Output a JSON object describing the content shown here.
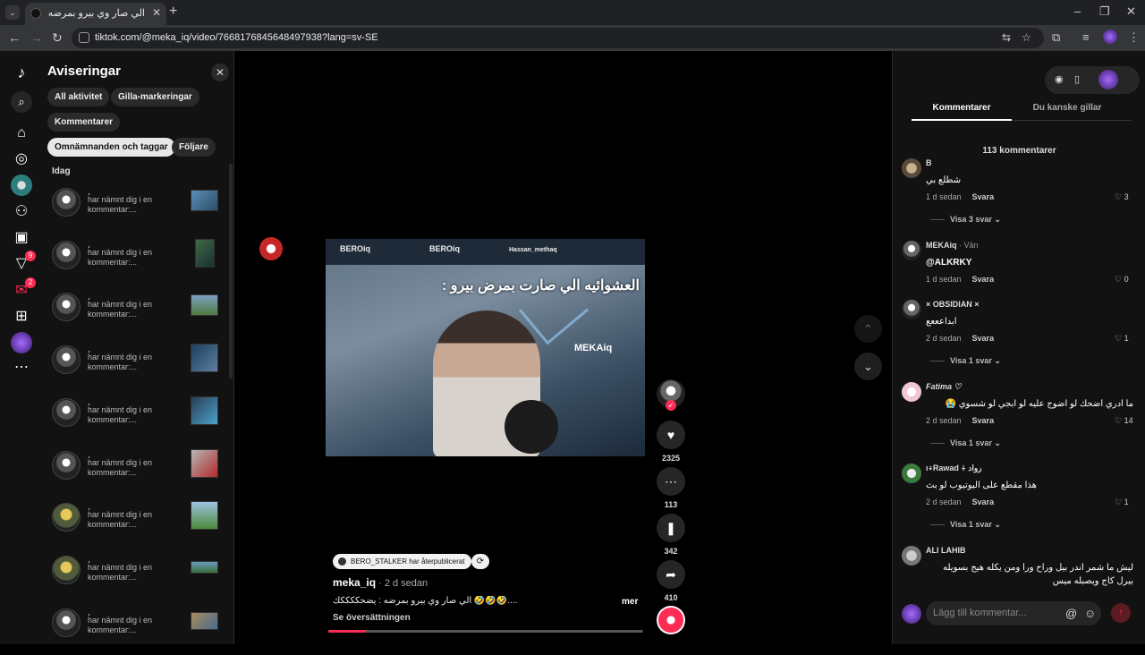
{
  "browser": {
    "tab_title": "الي صار وي بيرو بمرضه : يضحكككك",
    "url": "tiktok.com/@meka_iq/video/7668176845648497938?lang=sv-SE"
  },
  "rail": {
    "badges": {
      "inbox": "9",
      "messages": "2"
    }
  },
  "notifications": {
    "title": "Aviseringar",
    "chips": [
      "All aktivitet",
      "Gilla-markeringar",
      "Kommentarer",
      "Omnämnanden och taggar",
      "Följare"
    ],
    "active_chip": "Omnämnanden och taggar",
    "section": "Idag",
    "items": [
      {
        "user": "،",
        "text": "har nämnt dig i en kommentar:..."
      },
      {
        "user": "،",
        "text": "har nämnt dig i en kommentar:..."
      },
      {
        "user": "،",
        "text": "har nämnt dig i en kommentar:..."
      },
      {
        "user": "،",
        "text": "har nämnt dig i en kommentar:..."
      },
      {
        "user": "،",
        "text": "har nämnt dig i en kommentar:..."
      },
      {
        "user": "،",
        "text": "har nämnt dig i en kommentar:..."
      },
      {
        "user": "،",
        "text": "har nämnt dig i en kommentar:..."
      },
      {
        "user": "،",
        "text": "har nämnt dig i en kommentar:..."
      },
      {
        "user": "،",
        "text": "har nämnt dig i en kommentar:..."
      }
    ]
  },
  "video": {
    "frame_logos": [
      "BEROiq",
      "BEROiq",
      "Hassan_methaq"
    ],
    "frame_caption": "العشوائيه الي صارت بمرض بيرو :",
    "frame_tag": "MEKAiq",
    "repost_text": "BERO_STALKER har återpublicerat",
    "author": "meka_iq",
    "time": "· 2 d sedan",
    "description": "الي صار وي بيرو بمرضه : يضحككككك 🤣🤣🤣....",
    "more": "mer",
    "translate": "Se översättningen",
    "progress": 0.12,
    "likes": "2325",
    "comments": "113",
    "saves": "342",
    "shares": "410"
  },
  "comments_panel": {
    "tabs": [
      "Kommentarer",
      "Du kanske gillar"
    ],
    "count_label": "113 kommentarer",
    "comments": [
      {
        "user": "B",
        "tag": "",
        "text": "شطلع بي",
        "time": "1 d sedan",
        "reply": "Svara",
        "likes": "3",
        "replies": "Visa 3 svar"
      },
      {
        "user": "MEKAiq",
        "tag": "· Vän",
        "text": "@ALKRKY",
        "time": "1 d sedan",
        "reply": "Svara",
        "likes": "0",
        "replies": ""
      },
      {
        "user": "× OBSIDIAN ×",
        "tag": "",
        "text": "ابداعععع",
        "time": "2 d sedan",
        "reply": "Svara",
        "likes": "1",
        "replies": "Visa 1 svar"
      },
      {
        "user": "Fatima ♡",
        "tag": "",
        "text": "ما ادري اضحك لو اضوج عليه لو ابجي لو شسوي 😭",
        "time": "2 d sedan",
        "reply": "Svara",
        "likes": "14",
        "replies": "Visa 1 svar"
      },
      {
        "user": "ı⍣Rawad ⍭ رواد",
        "tag": "",
        "text": "هذا مقطع على اليوتيوب لو بث",
        "time": "2 d sedan",
        "reply": "Svara",
        "likes": "1",
        "replies": "Visa 1 svar"
      },
      {
        "user": "ALI LAHIB",
        "tag": "",
        "text": "ليش ما شمر اندر بيل وراح ورا ومن يكله هيج بسويله بيرل كاج ويصبله ميس",
        "time": "",
        "reply": "",
        "likes": "",
        "replies": ""
      }
    ],
    "input_placeholder": "Lägg till kommentar..."
  }
}
